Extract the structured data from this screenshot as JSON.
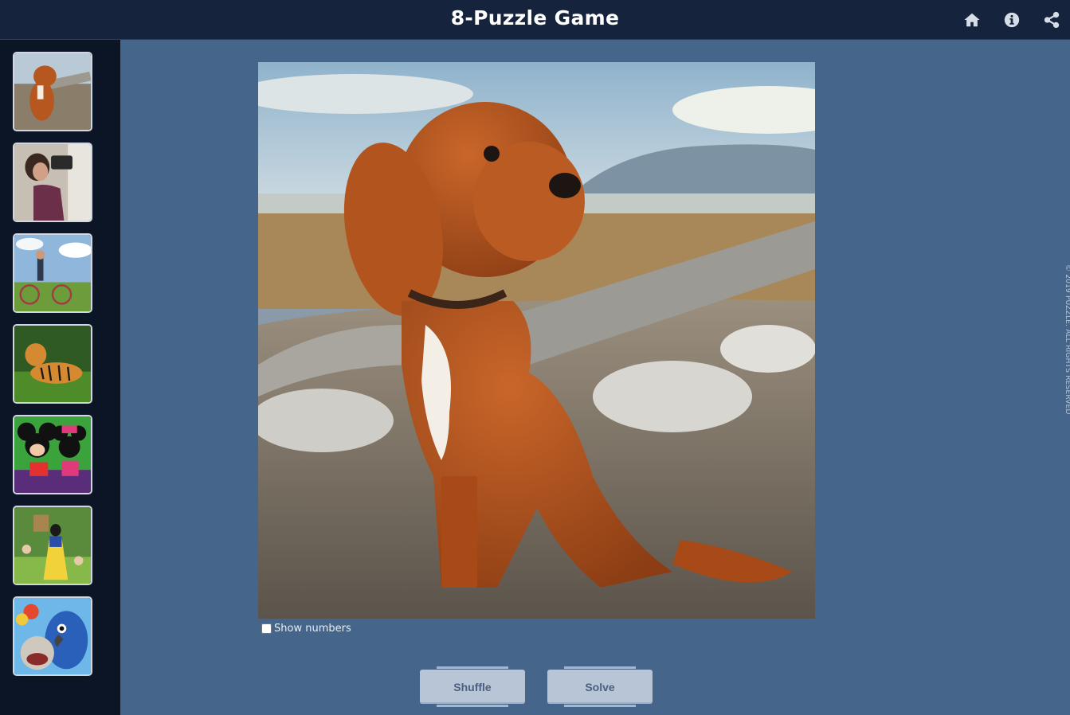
{
  "header": {
    "title": "8-Puzzle Game",
    "icons": [
      "home-icon",
      "info-icon",
      "share-icon"
    ]
  },
  "sidebar": {
    "thumbnails": [
      {
        "subject": "puppy"
      },
      {
        "subject": "photographer"
      },
      {
        "subject": "couple-bicycle"
      },
      {
        "subject": "tiger"
      },
      {
        "subject": "mickey-minnie"
      },
      {
        "subject": "snow-white"
      },
      {
        "subject": "rio-parrot"
      }
    ]
  },
  "puzzle": {
    "image_subject": "puppy",
    "show_numbers_label": "Show numbers",
    "show_numbers_checked": false
  },
  "controls": {
    "shuffle_label": "Shuffle",
    "solve_label": "Solve"
  },
  "footer": {
    "copyright": "© 2019 PUZZLE. ALL RIGHTS RESERVED"
  },
  "colors": {
    "header_bg": "#15233d",
    "sidebar_bg": "#0c1526",
    "main_bg": "#46658a",
    "button_bg": "#b8c5d6",
    "button_text": "#4a6080"
  }
}
